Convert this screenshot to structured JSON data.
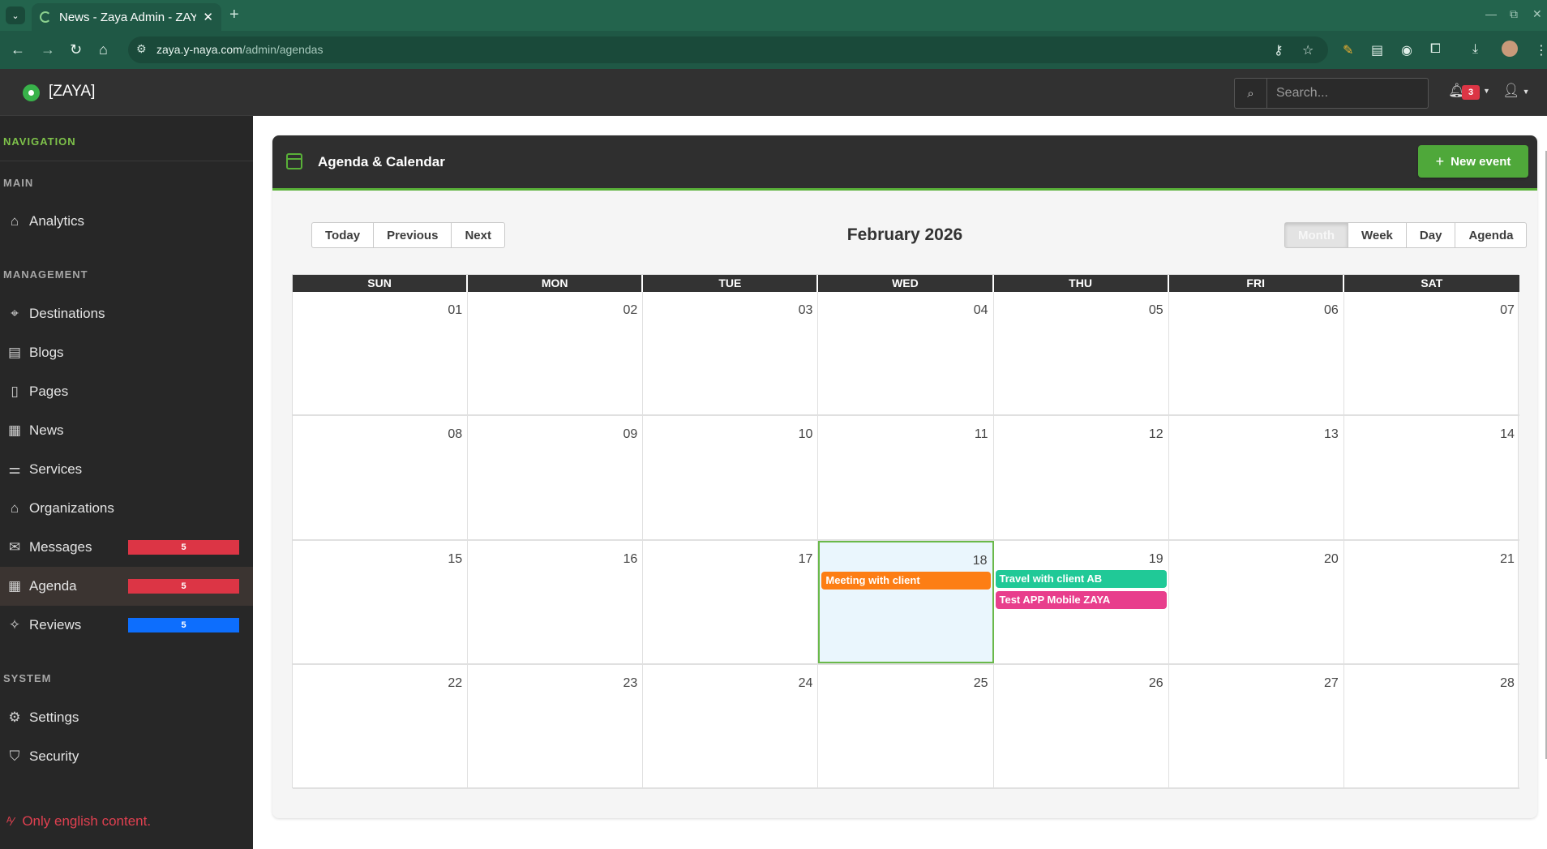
{
  "browser": {
    "tab_title": "News - Zaya Admin - ZAYA",
    "url_host": "zaya.y-naya.com",
    "url_path": "/admin/agendas"
  },
  "header": {
    "brand": "[ZAYA]",
    "search_placeholder": "Search...",
    "notifications_count": "3"
  },
  "sidebar": {
    "nav_heading": "NAVIGATION",
    "sections": {
      "main": "MAIN",
      "management": "MANAGEMENT",
      "system": "SYSTEM"
    },
    "items": [
      {
        "label": "Analytics",
        "icon": "home-icon"
      },
      {
        "label": "Destinations",
        "icon": "map-pin-icon"
      },
      {
        "label": "Blogs",
        "icon": "document-icon"
      },
      {
        "label": "Pages",
        "icon": "file-icon"
      },
      {
        "label": "News",
        "icon": "newspaper-icon"
      },
      {
        "label": "Services",
        "icon": "sliders-icon"
      },
      {
        "label": "Organizations",
        "icon": "building-icon"
      },
      {
        "label": "Messages",
        "icon": "envelope-icon",
        "badge": "5",
        "badge_color": "#dc3545"
      },
      {
        "label": "Agenda",
        "icon": "calendar-icon",
        "badge": "5",
        "badge_color": "#dc3545",
        "active": true
      },
      {
        "label": "Reviews",
        "icon": "sparkle-icon",
        "badge": "5",
        "badge_color": "#0d6efd"
      },
      {
        "label": "Settings",
        "icon": "gear-icon"
      },
      {
        "label": "Security",
        "icon": "shield-icon"
      }
    ],
    "language_note": "Only english content."
  },
  "card": {
    "title": "Agenda & Calendar",
    "new_event_label": "New event"
  },
  "toolbar": {
    "today": "Today",
    "previous": "Previous",
    "next": "Next",
    "month_label": "February 2026",
    "views": [
      "Month",
      "Week",
      "Day",
      "Agenda"
    ],
    "active_view": "Month"
  },
  "calendar": {
    "weekdays": [
      "SUN",
      "MON",
      "TUE",
      "WED",
      "THU",
      "FRI",
      "SAT"
    ],
    "weeks": [
      [
        "01",
        "02",
        "03",
        "04",
        "05",
        "06",
        "07"
      ],
      [
        "08",
        "09",
        "10",
        "11",
        "12",
        "13",
        "14"
      ],
      [
        "15",
        "16",
        "17",
        "18",
        "19",
        "20",
        "21"
      ],
      [
        "22",
        "23",
        "24",
        "25",
        "26",
        "27",
        "28"
      ]
    ],
    "today": "18",
    "events": [
      {
        "title": "Meeting with client",
        "day": "18",
        "color": "#fd7e14"
      },
      {
        "title": "Travel with client AB",
        "day": "19",
        "color": "#20c997"
      },
      {
        "title": "Test APP Mobile ZAYA",
        "day": "19",
        "color": "#e83e8c"
      }
    ]
  },
  "colors": {
    "accent_green": "#59b038",
    "danger": "#dc3545",
    "primary": "#0d6efd"
  }
}
